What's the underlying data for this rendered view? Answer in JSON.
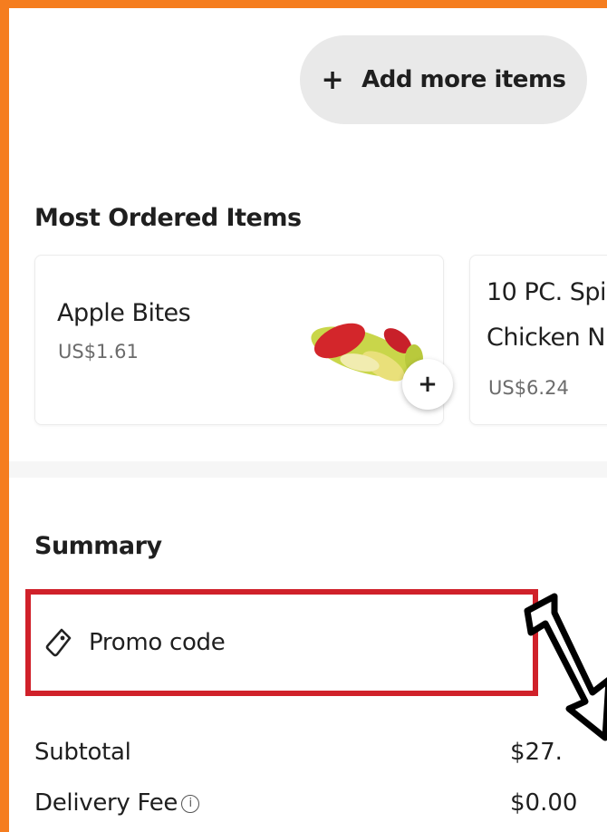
{
  "header": {
    "add_more_label": "Add more items"
  },
  "most_ordered": {
    "title": "Most Ordered Items",
    "items": [
      {
        "name": "Apple Bites",
        "price": "US$1.61"
      },
      {
        "name": "10 PC. Spi",
        "name_line2": "Chicken N",
        "price": "US$6.24"
      }
    ]
  },
  "summary": {
    "title": "Summary",
    "promo_label": "Promo code",
    "rows": [
      {
        "label": "Subtotal",
        "value": "$27."
      },
      {
        "label": "Delivery Fee",
        "value": "$0.00"
      }
    ]
  },
  "colors": {
    "highlight": "#d0212a",
    "page_border": "#f57d1f"
  }
}
